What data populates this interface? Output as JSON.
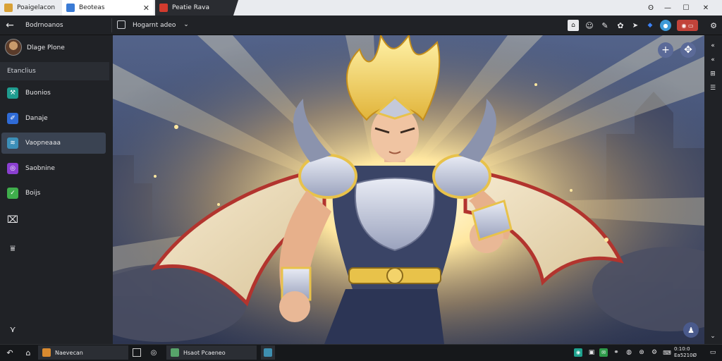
{
  "browser": {
    "tabs": [
      {
        "label": "Poaigelacon",
        "favicon_color": "#d9a136"
      },
      {
        "label": "Beoteas",
        "favicon_color": "#3a7bd5"
      },
      {
        "label": "Peatie Rava",
        "favicon_color": "#d23b2e"
      }
    ],
    "window_controls": [
      "minimize",
      "maximize",
      "close"
    ]
  },
  "appbar": {
    "back_label": "Bodrnoanos",
    "document_label": "Hogarnt adeo",
    "zoom_value": "Ø"
  },
  "sidebar": {
    "profile_name": "Dlage Plone",
    "section_label": "Etanclius",
    "items": [
      {
        "label": "Buonios",
        "color": "#1f9c8f",
        "icon": "tools-icon"
      },
      {
        "label": "Danaje",
        "color": "#2f6bd6",
        "icon": "brush-icon"
      },
      {
        "label": "Vaopneaaa",
        "color": "#3c8fb8",
        "icon": "layers-icon",
        "selected": true
      },
      {
        "label": "Saobnine",
        "color": "#8a3fd0",
        "icon": "filter-icon"
      },
      {
        "label": "Boijs",
        "color": "#3fae4c",
        "icon": "effects-icon"
      }
    ]
  },
  "canvas": {
    "accent_gold": "#e8c24a",
    "accent_red": "#b2342e",
    "sky_color": "#3b4868"
  },
  "taskbar": {
    "items": [
      {
        "label": "Naevecan",
        "color": "#d98a2f"
      },
      {
        "label": "Hsaot Pcaeneo",
        "color": "#57a36a"
      }
    ],
    "clock_line1": "0:10:0",
    "clock_line2": "Ea5210Ø"
  }
}
